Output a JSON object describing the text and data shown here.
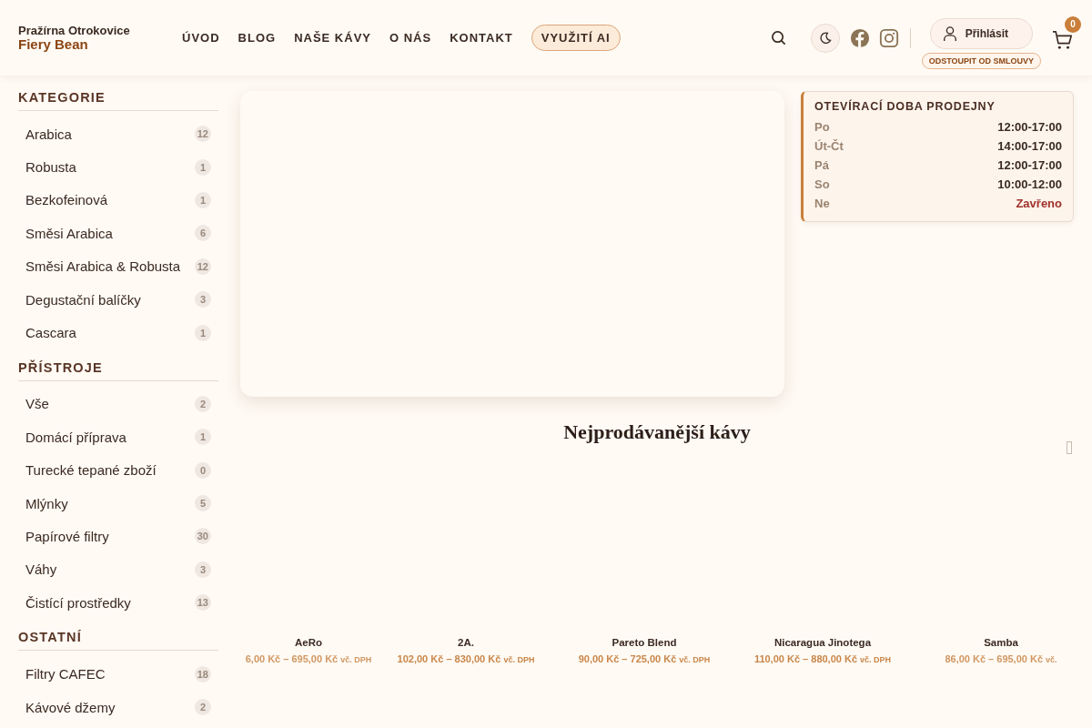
{
  "brand": {
    "top": "Pražírna Otrokovice",
    "name": "Fiery Bean"
  },
  "nav": [
    {
      "label": "ÚVOD",
      "kind": "link"
    },
    {
      "label": "BLOG",
      "kind": "link"
    },
    {
      "label": "NAŠE KÁVY",
      "kind": "link"
    },
    {
      "label": "O NÁS",
      "kind": "link"
    },
    {
      "label": "KONTAKT",
      "kind": "link"
    },
    {
      "label": "VYUŽITÍ AI",
      "kind": "pill"
    }
  ],
  "login": {
    "label": "Přihlásit",
    "withdraw": "ODSTOUPIT OD SMLOUVY"
  },
  "cart": {
    "count": "0"
  },
  "sidebar": [
    {
      "heading": "KATEGORIE",
      "items": [
        {
          "label": "Arabica",
          "count": "12"
        },
        {
          "label": "Robusta",
          "count": "1"
        },
        {
          "label": "Bezkofeinová",
          "count": "1"
        },
        {
          "label": "Směsi Arabica",
          "count": "6"
        },
        {
          "label": "Směsi Arabica & Robusta",
          "count": "12"
        },
        {
          "label": "Degustační balíčky",
          "count": "3"
        },
        {
          "label": "Cascara",
          "count": "1"
        }
      ]
    },
    {
      "heading": "PŘÍSTROJE",
      "items": [
        {
          "label": "Vše",
          "count": "2"
        },
        {
          "label": "Domácí příprava",
          "count": "1"
        },
        {
          "label": "Turecké tepané zboží",
          "count": "0"
        },
        {
          "label": "Mlýnky",
          "count": "5"
        },
        {
          "label": "Papírové filtry",
          "count": "30"
        },
        {
          "label": "Váhy",
          "count": "3"
        },
        {
          "label": "Čistící prostředky",
          "count": "13"
        }
      ]
    },
    {
      "heading": "OSTATNÍ",
      "items": [
        {
          "label": "Filtry CAFEC",
          "count": "18"
        },
        {
          "label": "Kávové džemy",
          "count": "2"
        }
      ]
    }
  ],
  "hours": {
    "title": "OTEVÍRACÍ DOBA PRODEJNY",
    "rows": [
      {
        "day": "Po",
        "time": "12:00-17:00",
        "closed": false
      },
      {
        "day": "Út-Čt",
        "time": "14:00-17:00",
        "closed": false
      },
      {
        "day": "Pá",
        "time": "12:00-17:00",
        "closed": false
      },
      {
        "day": "So",
        "time": "10:00-12:00",
        "closed": false
      },
      {
        "day": "Ne",
        "time": "Zavřeno",
        "closed": true
      }
    ]
  },
  "bestsellers": {
    "title": "Nejprodávanější kávy",
    "products": [
      {
        "name": "AeRo",
        "price": "6,00 Kč – 695,00 Kč",
        "tax": "vč. DPH"
      },
      {
        "name": "2A.",
        "price": "102,00 Kč – 830,00 Kč",
        "tax": "vč. DPH"
      },
      {
        "name": "Pareto Blend",
        "price": "90,00 Kč – 725,00 Kč",
        "tax": "vč. DPH"
      },
      {
        "name": "Nicaragua Jinotega",
        "price": "110,00 Kč – 880,00 Kč",
        "tax": "vč. DPH"
      },
      {
        "name": "Samba",
        "price": "86,00 Kč – 695,00 Kč",
        "tax": "vč."
      }
    ]
  }
}
